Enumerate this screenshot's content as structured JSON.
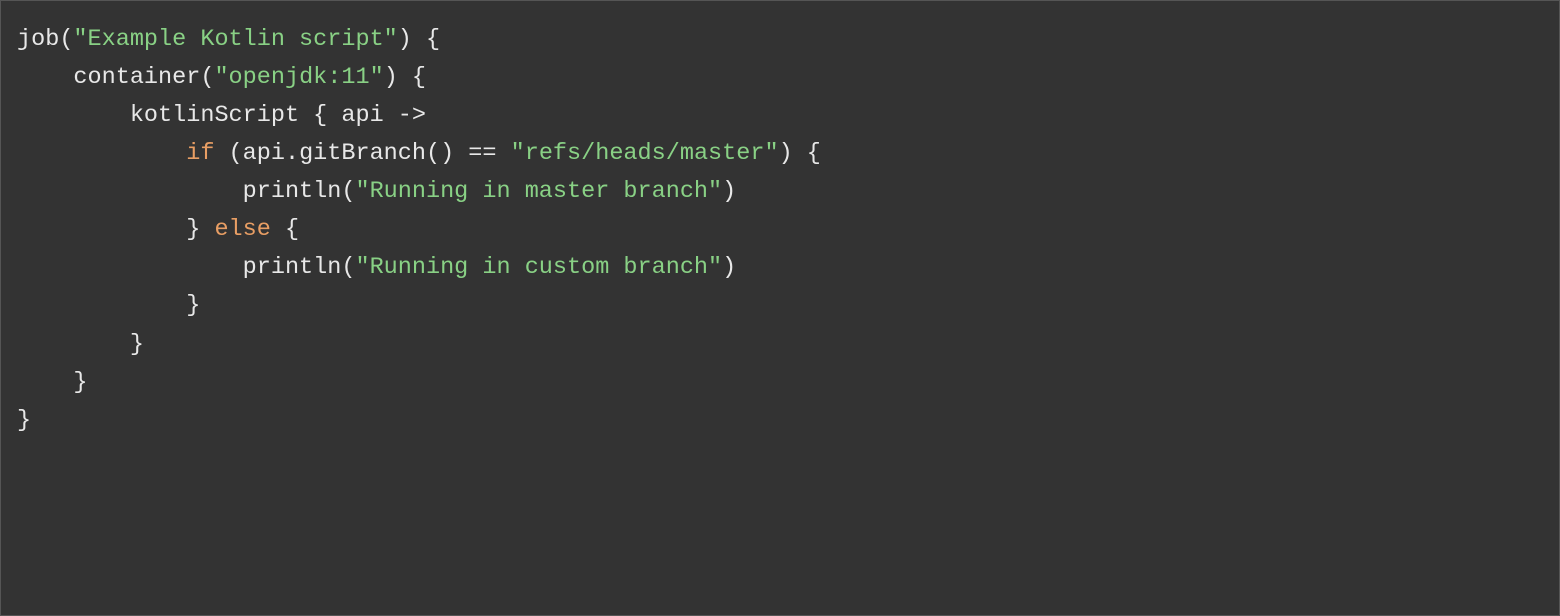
{
  "code": {
    "line1_job": "job",
    "line1_paren1": "(",
    "line1_str": "\"Example Kotlin script\"",
    "line1_paren2": ") {",
    "line2_indent": "    ",
    "line2_container": "container(",
    "line2_str": "\"openjdk:11\"",
    "line2_close": ") {",
    "line3_indent": "        ",
    "line3_text": "kotlinScript { api ->",
    "line4_indent": "            ",
    "line4_if": "if",
    "line4_cond1": " (api.gitBranch() == ",
    "line4_str": "\"refs/heads/master\"",
    "line4_cond2": ") {",
    "line5_indent": "                ",
    "line5_println": "println(",
    "line5_str": "\"Running in master branch\"",
    "line5_close": ")",
    "line6_indent": "            ",
    "line6_brace": "} ",
    "line6_else": "else",
    "line6_open": " {",
    "line7_indent": "                ",
    "line7_println": "println(",
    "line7_str": "\"Running in custom branch\"",
    "line7_close": ")",
    "line8_indent": "            ",
    "line8_brace": "}",
    "line9_indent": "        ",
    "line9_brace": "}",
    "line10_indent": "    ",
    "line10_brace": "}",
    "line11_brace": "}"
  }
}
